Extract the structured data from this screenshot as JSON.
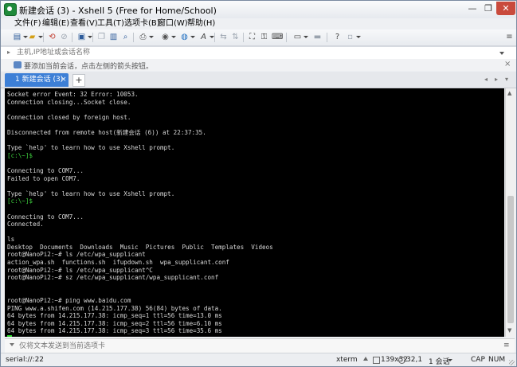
{
  "window": {
    "title": "新建会话 (3) - Xshell 5 (Free for Home/School)",
    "min_glyph": "—",
    "max_glyph": "❐",
    "close_glyph": "✕"
  },
  "menu": [
    "文件(F)",
    "编辑(E)",
    "查看(V)",
    "工具(T)",
    "选项卡(B)",
    "窗口(W)",
    "帮助(H)"
  ],
  "toolbar_icons": [
    "new-session-icon",
    "open-folder-icon",
    "reconnect-icon",
    "disconnect-icon",
    "properties-icon",
    "copy-icon",
    "paste-icon",
    "find-icon",
    "print-icon",
    "color-scheme-icon",
    "globe-icon",
    "font-icon",
    "transfer-icon",
    "xftp-icon",
    "fullscreen-icon",
    "lock-icon",
    "keyboard-icon",
    "script-icon",
    "compose-icon",
    "help-icon",
    "more-icon"
  ],
  "address_bar": {
    "placeholder": "主机,IP地址或会话名称"
  },
  "hint_bar": {
    "text": "要添加当前会话，点击左侧的箭头按钮。",
    "close_glyph": "×"
  },
  "tabs": {
    "active": {
      "label": "1 新建会话 (3)",
      "close_glyph": "×"
    },
    "add_glyph": "+",
    "nav_left": "◂",
    "nav_right": "▸",
    "nav_menu": "▾"
  },
  "terminal": {
    "lines": [
      "Socket error Event: 32 Error: 10053.",
      "Connection closing...Socket close.",
      "",
      "Connection closed by foreign host.",
      "",
      "Disconnected from remote host(新建会话 (6)) at 22:37:35.",
      "",
      "Type `help' to learn how to use Xshell prompt.",
      "[c:\\~]$",
      "",
      "Connecting to COM7...",
      "Failed to open COM7.",
      "",
      "Type `help' to learn how to use Xshell prompt.",
      "[c:\\~]$",
      "",
      "Connecting to COM7...",
      "Connected.",
      "",
      "ls",
      "Desktop  Documents  Downloads  Music  Pictures  Public  Templates  Videos",
      "root@NanoPi2:~# ls /etc/wpa_supplicant",
      "action_wpa.sh  functions.sh  ifupdown.sh  wpa_supplicant.conf",
      "root@NanoPi2:~# ls /etc/wpa_supplicant^C",
      "root@NanoPi2:~# sz /etc/wpa_supplicant/wpa_supplicant.conf",
      "",
      "",
      "root@NanoPi2:~# ping www.baidu.com",
      "PING www.a.shifen.com (14.215.177.38) 56(84) bytes of data.",
      "64 bytes from 14.215.177.38: icmp_seq=1 ttl=56 time=13.0 ms",
      "64 bytes from 14.215.177.38: icmp_seq=2 ttl=56 time=6.10 ms",
      "64 bytes from 14.215.177.38: icmp_seq=3 ttl=56 time=35.6 ms"
    ],
    "prompt_line_indexes": [
      8,
      14
    ],
    "colors": {
      "background": "#000000",
      "text": "#d8d8d8",
      "prompt": "#3fd23f",
      "cursor": "#28d228"
    }
  },
  "compose_bar": {
    "placeholder": "仅将文本发送到当前选项卡",
    "menu_glyph": "≡"
  },
  "status_bar": {
    "connection": "serial://:22",
    "terminal_type": "xterm",
    "size": "139x32",
    "cursor_pos": "32,1",
    "sessions": "1 会话",
    "caps": "CAP",
    "num": "NUM"
  },
  "scrollbar": {
    "up": "▲",
    "down": "▼"
  },
  "accent_color": "#3d7fd6"
}
